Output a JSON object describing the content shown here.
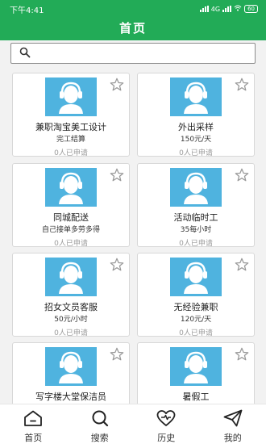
{
  "status_bar": {
    "time": "下午4:41",
    "indicators": "4G",
    "battery": "60"
  },
  "header": {
    "title": "首页"
  },
  "search": {
    "placeholder": ""
  },
  "jobs": [
    {
      "title": "兼职淘宝美工设计",
      "pay": "完工结算",
      "applied": "0人已申请"
    },
    {
      "title": "外出采样",
      "pay": "150元/天",
      "applied": "0人已申请"
    },
    {
      "title": "同城配送",
      "pay": "自己接单多劳多得",
      "applied": "0人已申请"
    },
    {
      "title": "活动临时工",
      "pay": "35每小时",
      "applied": "0人已申请"
    },
    {
      "title": "招女文员客服",
      "pay": "50元/小时",
      "applied": "0人已申请"
    },
    {
      "title": "无经验兼职",
      "pay": "120元/天",
      "applied": "0人已申请"
    },
    {
      "title": "写字楼大堂保洁员",
      "pay": "",
      "applied": ""
    },
    {
      "title": "暑假工",
      "pay": "",
      "applied": ""
    }
  ],
  "tabs": [
    {
      "label": "首页",
      "icon": "home-icon"
    },
    {
      "label": "搜索",
      "icon": "search-icon"
    },
    {
      "label": "历史",
      "icon": "heart-icon"
    },
    {
      "label": "我的",
      "icon": "paper-plane-icon"
    }
  ],
  "colors": {
    "brand_green": "#22ab57",
    "avatar_blue": "#4fb3df"
  }
}
